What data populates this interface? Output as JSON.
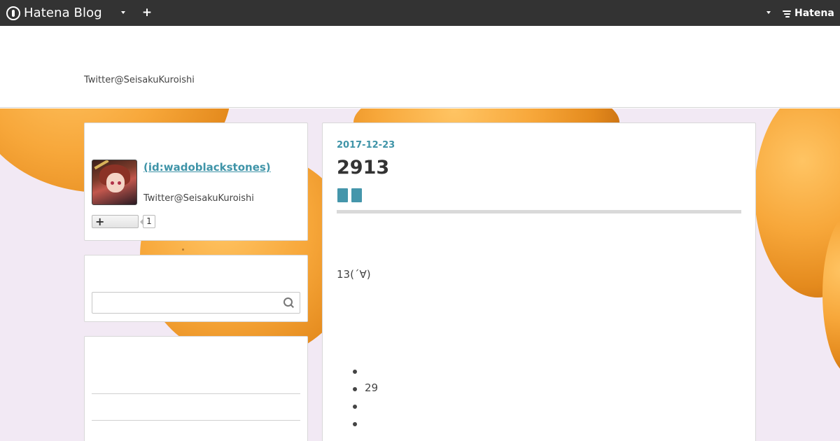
{
  "topbar": {
    "brand": "Hatena Blog",
    "plus_label": "+",
    "hatena_label": "Hatena"
  },
  "header": {
    "description": "Twitter@SeisakuKuroishi"
  },
  "sidebar": {
    "profile": {
      "name": " (id:wadoblackstones)",
      "description": "Twitter@SeisakuKuroishi",
      "follow_label": "+",
      "follower_count": "1"
    },
    "search": {
      "value": "",
      "placeholder": ""
    }
  },
  "entry": {
    "date": "2017-12-23",
    "title": "2913",
    "body": "13(´∀)",
    "list_items": [
      "",
      "29",
      "",
      ""
    ]
  },
  "colors": {
    "topbar": "#333333",
    "accent": "#3f94a8",
    "category": "#4596ab",
    "background": "#f2e9f4",
    "orange": "#f7a73a"
  },
  "icons": {
    "logo": "hatena-logo-icon",
    "menu_caret": "caret-down-icon",
    "add": "plus-icon",
    "search": "search-icon",
    "follow": "plus-icon"
  }
}
